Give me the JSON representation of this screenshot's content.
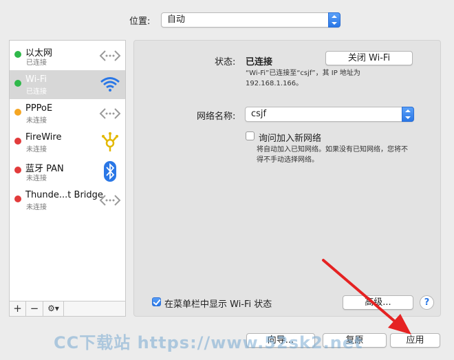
{
  "location": {
    "label": "位置:",
    "value": "自动"
  },
  "services": [
    {
      "name": "以太网",
      "status": "已连接",
      "dot_color": "#2fb84a",
      "icon": "ethernet-icon"
    },
    {
      "name": "Wi-Fi",
      "status": "已连接",
      "dot_color": "#2fb84a",
      "icon": "wifi-icon"
    },
    {
      "name": "PPPoE",
      "status": "未连接",
      "dot_color": "#f5a623",
      "icon": "ethernet-icon"
    },
    {
      "name": "FireWire",
      "status": "未连接",
      "dot_color": "#e23b3b",
      "icon": "firewire-icon"
    },
    {
      "name": "蓝牙 PAN",
      "status": "未连接",
      "dot_color": "#e23b3b",
      "icon": "bluetooth-icon"
    },
    {
      "name": "Thunde...t Bridge",
      "status": "未连接",
      "dot_color": "#e23b3b",
      "icon": "ethernet-icon"
    }
  ],
  "toolbar": {
    "add": "+",
    "remove": "−",
    "gear": "⚙▾"
  },
  "detail": {
    "status_label": "状态:",
    "status_value": "已连接",
    "turn_off_button": "关闭 Wi-Fi",
    "status_desc_line1": "“Wi-Fi”已连接至“csjf”，其 IP 地址为",
    "status_desc_line2": "192.168.1.166。",
    "network_name_label": "网络名称:",
    "network_name_value": "csjf",
    "ask_join_label": "询问加入新网络",
    "ask_join_desc_line1": "将自动加入已知网络。如果没有已知网络，您将不",
    "ask_join_desc_line2": "得不手动选择网络。",
    "show_menubar_label": "在菜单栏中显示 Wi-Fi 状态",
    "advanced_button": "高级...",
    "help_button": "?"
  },
  "footer": {
    "assist_button": "向导...",
    "revert_button": "复原",
    "apply_button": "应用"
  },
  "watermark": "CC下载站 https://www.52sk2.net",
  "colors": {
    "accent": "#2a77e6",
    "selected_row": "#d7d7d7",
    "arrow": "#e52222"
  }
}
